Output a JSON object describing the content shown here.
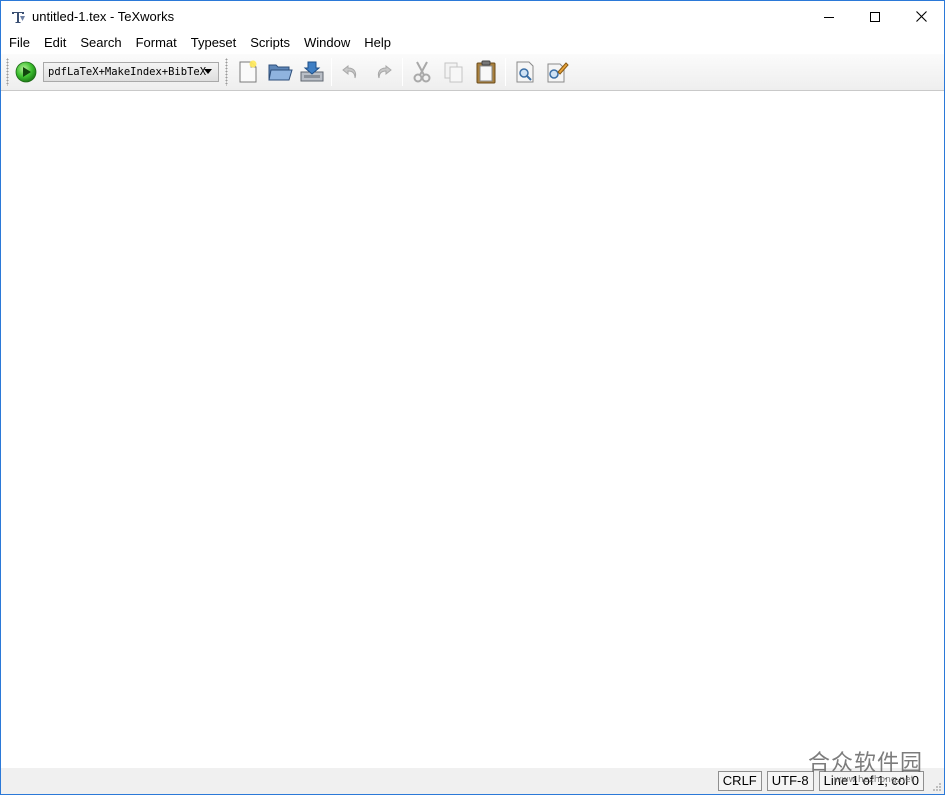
{
  "window": {
    "title": "untitled-1.tex - TeXworks",
    "controls": {
      "minimize_icon": "minimize-icon",
      "maximize_icon": "maximize-icon",
      "close_icon": "close-icon"
    }
  },
  "menu": {
    "items": [
      "File",
      "Edit",
      "Search",
      "Format",
      "Typeset",
      "Scripts",
      "Window",
      "Help"
    ]
  },
  "toolbar": {
    "engine": "pdfLaTeX+MakeIndex+BibTeX",
    "icons": {
      "typeset": "play-icon",
      "new": "new-document-icon",
      "open": "open-folder-icon",
      "save": "save-icon",
      "undo": "undo-icon",
      "redo": "redo-icon",
      "cut": "cut-icon",
      "copy": "copy-icon",
      "paste": "paste-icon",
      "find": "find-icon",
      "replace": "find-replace-icon"
    }
  },
  "status": {
    "line_ending": "CRLF",
    "encoding": "UTF-8",
    "position": "Line 1 of 1; col 0"
  },
  "watermark": {
    "main": "合众软件园",
    "sub": "www.hezhong.net"
  },
  "colors": {
    "window_border": "#2b79d8",
    "toolbar_bg": "#eeeeee",
    "statusbar_bg": "#f0f0f0",
    "play_green": "#3cbf2f"
  }
}
